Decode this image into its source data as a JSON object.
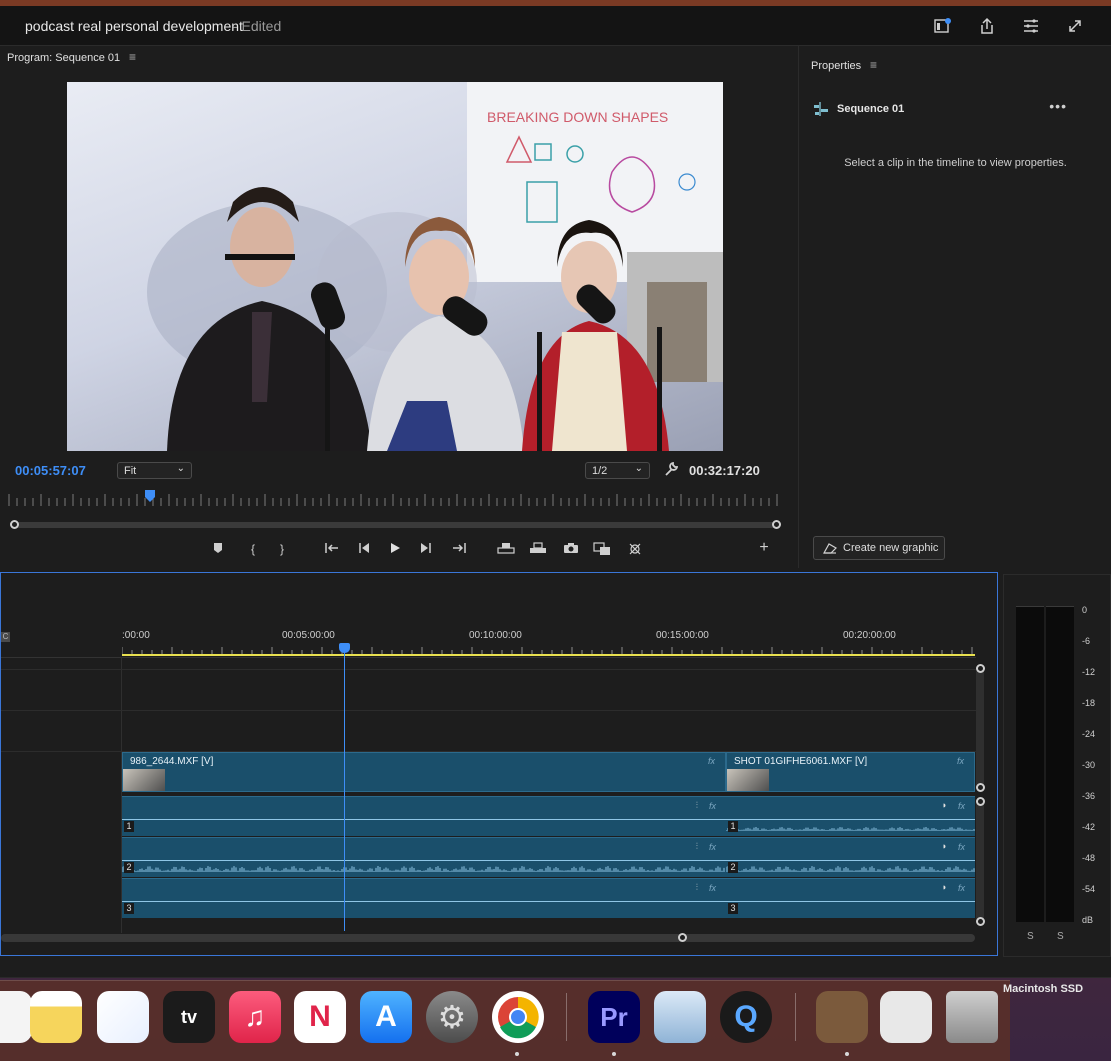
{
  "window": {
    "project_title": "podcast real personal development",
    "edited_label": "- Edited"
  },
  "program_monitor": {
    "title": "Program: Sequence 01",
    "menu_icon": "hamburger-icon",
    "current_timecode": "00:05:57:07",
    "duration_timecode": "00:32:17:20",
    "zoom_select": "Fit",
    "resolution_select": "1/2",
    "playhead_fraction": 0.184,
    "whiteboard_text": "BREAKING DOWN SHAPES"
  },
  "properties": {
    "title": "Properties",
    "sequence_name": "Sequence 01",
    "empty_message": "Select a clip in the timeline to view properties.",
    "more_label": "•••",
    "create_graphic_label": "Create new graphic"
  },
  "timeline": {
    "ruler_labels": [
      ":00:00",
      "00:05:00:00",
      "00:10:00:00",
      "00:15:00:00",
      "00:20:00:00"
    ],
    "video_clips": [
      {
        "name": "986_2644.MXF [V]"
      },
      {
        "name": "SHOT 01GIFHE6061.MXF [V]"
      }
    ],
    "audio_track_numbers": [
      "1",
      "2",
      "3"
    ],
    "fx_label": "fx",
    "clipped_label": "C"
  },
  "audio_meter": {
    "db_labels": [
      "0",
      "-6",
      "-12",
      "-18",
      "-24",
      "-30",
      "-36",
      "-42",
      "-48",
      "-54",
      "dB"
    ],
    "solo_labels": [
      "S",
      "S"
    ]
  },
  "dock": {
    "items": [
      {
        "name": "Notes",
        "icon": "notes-icon"
      },
      {
        "name": "Freeform",
        "icon": "freeform-icon"
      },
      {
        "name": "Apple TV",
        "icon": "appletv-icon",
        "label": "tv"
      },
      {
        "name": "Music",
        "icon": "music-icon",
        "label": "♫"
      },
      {
        "name": "News",
        "icon": "news-icon",
        "label": "N"
      },
      {
        "name": "App Store",
        "icon": "appstore-icon",
        "label": "A"
      },
      {
        "name": "System Settings",
        "icon": "settings-icon",
        "label": "⚙"
      },
      {
        "name": "Chrome",
        "icon": "chrome-icon"
      },
      {
        "name": "Premiere Pro",
        "icon": "premiere-icon",
        "label": "Pr"
      },
      {
        "name": "Preview",
        "icon": "preview-icon"
      },
      {
        "name": "QuickTime Player",
        "icon": "quicktime-icon",
        "label": "Q"
      },
      {
        "name": "Photo",
        "icon": "photo-thumb-icon"
      },
      {
        "name": "Chrome Window",
        "icon": "chrome-window-icon"
      },
      {
        "name": "Trash",
        "icon": "trash-icon"
      }
    ],
    "drive_label": "Macintosh SSD"
  },
  "colors": {
    "accent_blue": "#3e8ef7",
    "clip_teal": "#1a4f6b",
    "waveform": "#8fc6e6",
    "work_area_yellow": "#e8e050"
  }
}
